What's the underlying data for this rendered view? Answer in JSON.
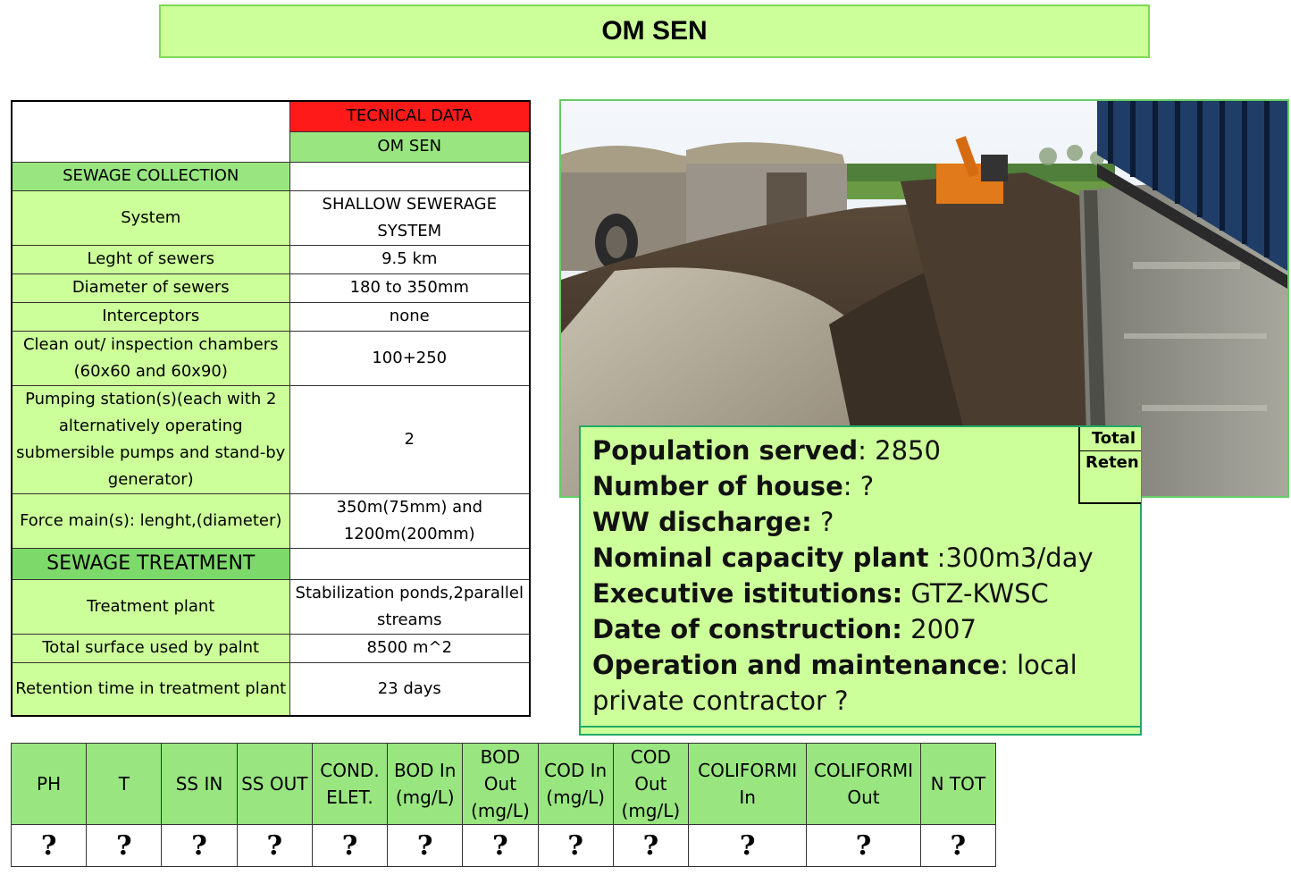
{
  "title": "OM SEN",
  "tech": {
    "header_red": "TECNICAL DATA",
    "header_green": "OM SEN",
    "sec_collection": "SEWAGE COLLECTION",
    "sec_treatment": "SEWAGE TREATMENT",
    "rows": [
      {
        "label": "System",
        "value": "SHALLOW SEWERAGE SYSTEM"
      },
      {
        "label": "Leght of sewers",
        "value": "9.5 km"
      },
      {
        "label": "Diameter of sewers",
        "value": "180 to 350mm"
      },
      {
        "label": "Interceptors",
        "value": "none"
      },
      {
        "label": "Clean out/ inspection chambers (60x60 and 60x90)",
        "value": "100+250"
      },
      {
        "label": "Pumping station(s)(each with 2 alternatively operating submersible pumps and stand-by generator)",
        "value": "2"
      },
      {
        "label": "Force main(s): lenght,(diameter)",
        "value": "350m(75mm) and 1200m(200mm)"
      },
      {
        "label": "Treatment plant",
        "value": "Stabilization ponds,2parallel streams"
      },
      {
        "label": "Total surface used by palnt",
        "value": "8500 m^2"
      },
      {
        "label": "Retention time in treatment plant",
        "value": "23 days"
      }
    ]
  },
  "info": {
    "population_label": "Population served",
    "population_value": ": 2850",
    "houses_label": "Number of house",
    "houses_value": ": ?",
    "ww_label": "WW discharge:",
    "ww_value": " ?",
    "capacity_label": "Nominal capacity plant",
    "capacity_value": " :300m3/day",
    "exec_label": "Executive istitutions:",
    "exec_value": " GTZ-KWSC",
    "date_label": "Date of construction:",
    "date_value": " 2007",
    "om_label": "Operation and maintenance",
    "om_value": ": local",
    "om_value2": "private contractor ?"
  },
  "mini": {
    "line1": "Total",
    "line2": "Reten"
  },
  "params": {
    "headers": [
      "PH",
      "T",
      "SS IN",
      "SS OUT",
      "COND. ELET.",
      "BOD In (mg/L)",
      "BOD Out (mg/L)",
      "COD In (mg/L)",
      "COD Out (mg/L)",
      "COLIFORMI In",
      "COLIFORMI Out",
      "N TOT"
    ],
    "values": [
      "?",
      "?",
      "?",
      "?",
      "?",
      "?",
      "?",
      "?",
      "?",
      "?",
      "?",
      "?"
    ]
  }
}
